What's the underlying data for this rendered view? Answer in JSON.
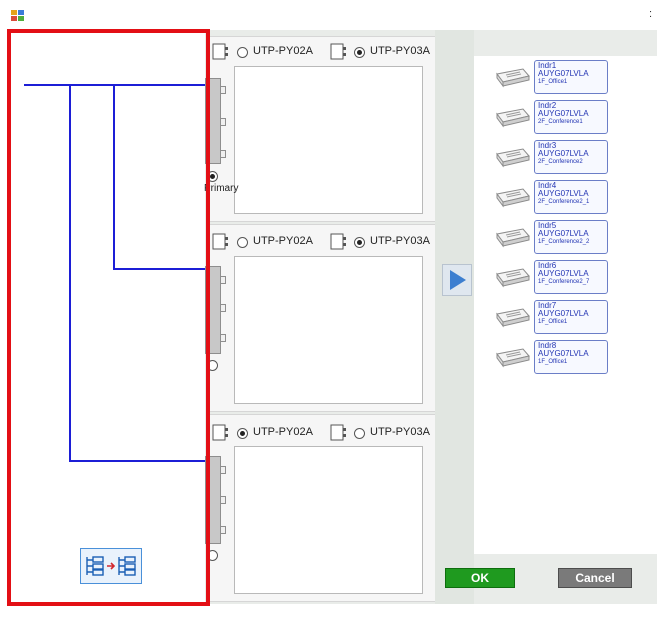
{
  "window": {
    "title": "",
    "title_fragment": ":"
  },
  "units": [
    {
      "option_a": "UTP-PY02A",
      "option_b": "UTP-PY03A",
      "selected": "b",
      "port_label": "Primary"
    },
    {
      "option_a": "UTP-PY02A",
      "option_b": "UTP-PY03A",
      "selected": "b",
      "port_label": ""
    },
    {
      "option_a": "UTP-PY02A",
      "option_b": "UTP-PY03A",
      "selected": "a",
      "port_label": ""
    }
  ],
  "indoor_units": [
    {
      "name": "Indr1",
      "model": "AUYG07LVLA",
      "room": "1F_Office1"
    },
    {
      "name": "Indr2",
      "model": "AUYG07LVLA",
      "room": "2F_Conference1"
    },
    {
      "name": "Indr3",
      "model": "AUYG07LVLA",
      "room": "2F_Conference2"
    },
    {
      "name": "Indr4",
      "model": "AUYG07LVLA",
      "room": "2F_Conference2_1"
    },
    {
      "name": "Indr5",
      "model": "AUYG07LVLA",
      "room": "1F_Conference2_2"
    },
    {
      "name": "Indr6",
      "model": "AUYG07LVLA",
      "room": "1F_Conference2_7"
    },
    {
      "name": "Indr7",
      "model": "AUYG07LVLA",
      "room": "1F_Office1"
    },
    {
      "name": "Indr8",
      "model": "AUYG07LVLA",
      "room": "1F_Office1"
    }
  ],
  "buttons": {
    "ok": "OK",
    "cancel": "Cancel"
  },
  "colors": {
    "highlight": "#e30f15",
    "piping_line": "#1c1ed6",
    "ok": "#1f9a1f",
    "cancel": "#7a7a7a",
    "label_text": "#2234b3"
  },
  "icons": {
    "app": "app-icon",
    "move_right": "play-arrow-icon",
    "tool": "arrange-tree-icon",
    "indoor": "cassette-unit-icon",
    "branch_box": "branch-box-icon"
  }
}
